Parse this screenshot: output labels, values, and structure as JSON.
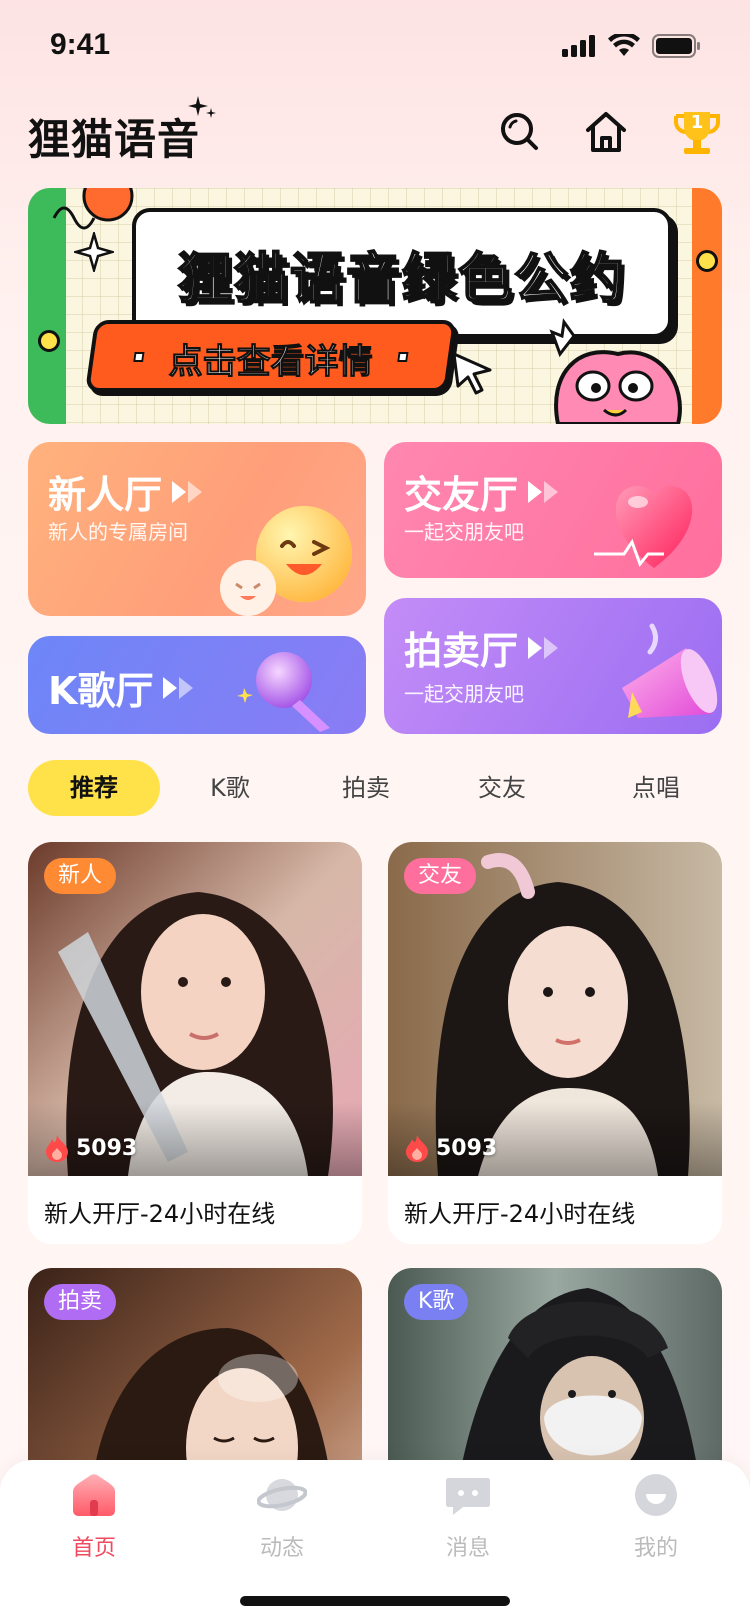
{
  "status_bar": {
    "time": "9:41"
  },
  "header": {
    "logo_text": "狸猫语音",
    "icons": [
      "search-icon",
      "home-icon",
      "trophy-icon"
    ],
    "trophy_badge": "1"
  },
  "banner": {
    "title": "狸猫语音绿色公约",
    "button_label": "点击查看详情"
  },
  "halls": [
    {
      "title": "新人厅",
      "subtitle": "新人的专属房间"
    },
    {
      "title": "交友厅",
      "subtitle": "一起交朋友吧"
    },
    {
      "title": "K歌厅",
      "subtitle": ""
    },
    {
      "title": "拍卖厅",
      "subtitle": "一起交朋友吧"
    }
  ],
  "tabs": [
    {
      "label": "推荐",
      "active": true
    },
    {
      "label": "K歌",
      "active": false
    },
    {
      "label": "拍卖",
      "active": false
    },
    {
      "label": "交友",
      "active": false
    },
    {
      "label": "点唱",
      "active": false
    }
  ],
  "rooms": [
    {
      "badge": "新人",
      "badge_color": "#ff8a34",
      "heat": "5093",
      "title": "新人开厅-24小时在线"
    },
    {
      "badge": "交友",
      "badge_color": "#ff6f9e",
      "heat": "5093",
      "title": "新人开厅-24小时在线"
    },
    {
      "badge": "拍卖",
      "badge_color": "#b06cf2",
      "heat": "",
      "title": ""
    },
    {
      "badge": "K歌",
      "badge_color": "#7a7ff2",
      "heat": "",
      "title": ""
    }
  ],
  "tabbar": [
    {
      "label": "首页",
      "icon": "home-icon",
      "active": true
    },
    {
      "label": "动态",
      "icon": "planet-icon",
      "active": false
    },
    {
      "label": "消息",
      "icon": "message-icon",
      "active": false
    },
    {
      "label": "我的",
      "icon": "profile-icon",
      "active": false
    }
  ],
  "colors": {
    "accent_yellow": "#ffe24a",
    "tab_active": "#f04a5e",
    "hall_newbie": "#ff9a6a",
    "hall_friend": "#ff6f9e",
    "hall_ktv": "#7b7ff5",
    "hall_auction": "#b57cf5"
  }
}
